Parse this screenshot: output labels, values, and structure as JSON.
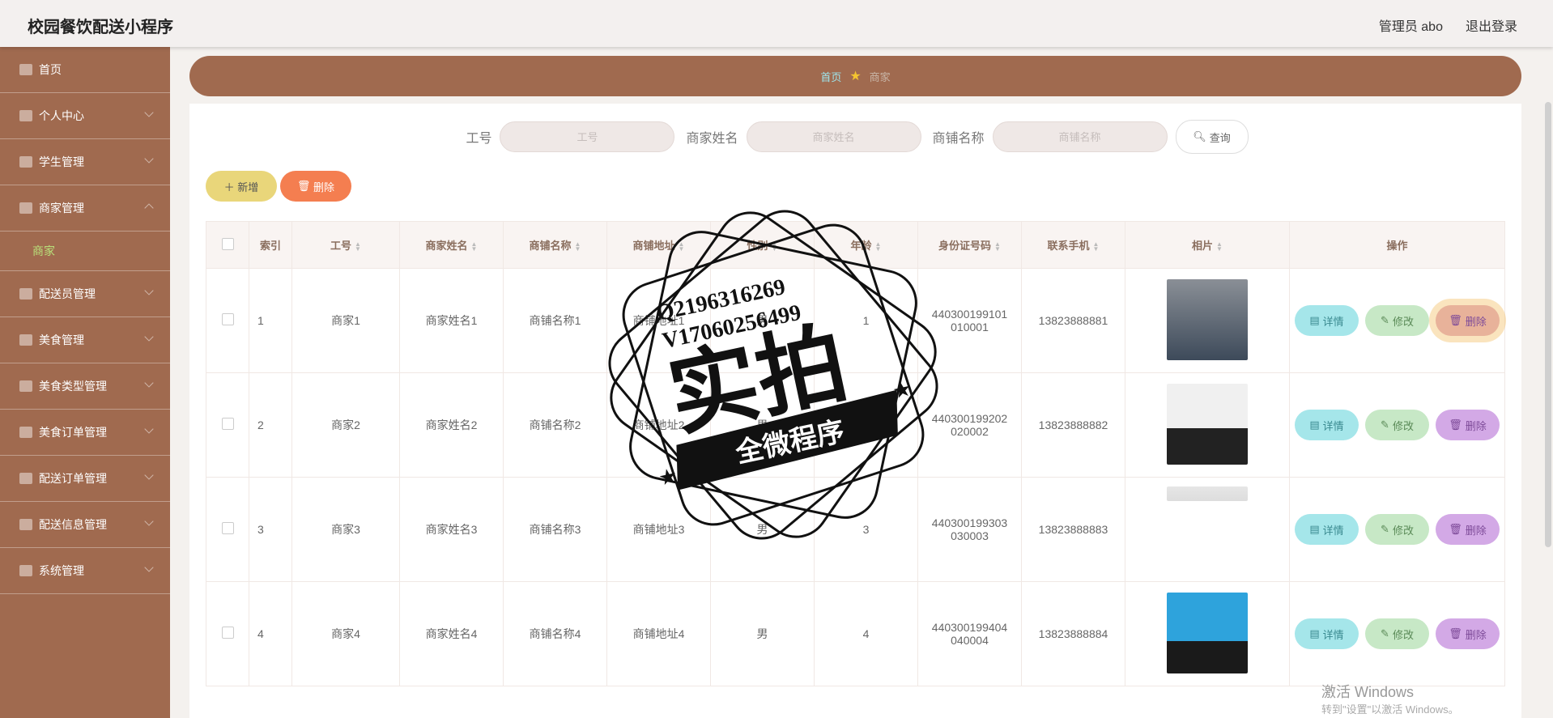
{
  "app": {
    "title": "校园餐饮配送小程序",
    "user": "管理员 abo",
    "logout": "退出登录"
  },
  "sidebar": {
    "items": [
      {
        "label": "首页",
        "icon": "home-icon",
        "chevron": false
      },
      {
        "label": "个人中心",
        "icon": "user-icon",
        "chevron": true
      },
      {
        "label": "学生管理",
        "icon": "grid-icon",
        "chevron": true
      },
      {
        "label": "商家管理",
        "icon": "card-icon",
        "chevron": true,
        "expanded": true
      },
      {
        "label": "配送员管理",
        "icon": "ball-icon",
        "chevron": true
      },
      {
        "label": "美食管理",
        "icon": "table-icon",
        "chevron": true
      },
      {
        "label": "美食类型管理",
        "icon": "list-icon",
        "chevron": true
      },
      {
        "label": "美食订单管理",
        "icon": "monitor-icon",
        "chevron": true
      },
      {
        "label": "配送订单管理",
        "icon": "lines-icon",
        "chevron": true
      },
      {
        "label": "配送信息管理",
        "icon": "send-icon",
        "chevron": true
      },
      {
        "label": "系统管理",
        "icon": "gear-icon",
        "chevron": true
      }
    ],
    "sub_item": "商家"
  },
  "breadcrumb": {
    "home": "首页",
    "current": "商家"
  },
  "search": {
    "label1": "工号",
    "placeholder1": "工号",
    "label2": "商家姓名",
    "placeholder2": "商家姓名",
    "label3": "商铺名称",
    "placeholder3": "商铺名称",
    "query": "查询"
  },
  "actions": {
    "add": "新增",
    "delete": "删除"
  },
  "table": {
    "headers": [
      "索引",
      "工号",
      "商家姓名",
      "商铺名称",
      "商铺地址",
      "性别",
      "年龄",
      "身份证号码",
      "联系手机",
      "相片",
      "操作"
    ],
    "rows": [
      {
        "idx": "1",
        "gonghao": "商家1",
        "name": "商家姓名1",
        "shop": "商铺名称1",
        "addr": "商铺地址1",
        "gender": "男",
        "age": "1",
        "id1": "440300199101",
        "id2": "010001",
        "phone": "13823888881",
        "photo_color": "#5a6a7a"
      },
      {
        "idx": "2",
        "gonghao": "商家2",
        "name": "商家姓名2",
        "shop": "商铺名称2",
        "addr": "商铺地址2",
        "gender": "男",
        "age": "2",
        "id1": "440300199202",
        "id2": "020002",
        "phone": "13823888882",
        "photo_color": "#e8e8e8"
      },
      {
        "idx": "3",
        "gonghao": "商家3",
        "name": "商家姓名3",
        "shop": "商铺名称3",
        "addr": "商铺地址3",
        "gender": "男",
        "age": "3",
        "id1": "440300199303",
        "id2": "030003",
        "phone": "13823888883",
        "photo_color": "#ffffff"
      },
      {
        "idx": "4",
        "gonghao": "商家4",
        "name": "商家姓名4",
        "shop": "商铺名称4",
        "addr": "商铺地址4",
        "gender": "男",
        "age": "4",
        "id1": "440300199404",
        "id2": "040004",
        "phone": "13823888884",
        "photo_color": "#2e9fd8"
      }
    ],
    "op_detail": "详情",
    "op_edit": "修改",
    "op_delete": "删除"
  },
  "watermark": {
    "line1": "Q2196316269",
    "line2": "V17060256499",
    "big": "实拍",
    "ribbon": "全微程序"
  },
  "windows": {
    "line1": "激活 Windows",
    "line2": "转到\"设置\"以激活 Windows。"
  }
}
